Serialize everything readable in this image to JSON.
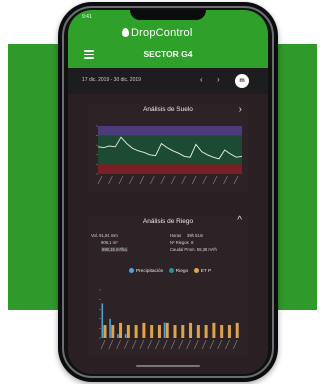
{
  "status": {
    "time": "9:41"
  },
  "app": {
    "name": "DropControl",
    "screen_title": "SECTOR G4"
  },
  "date_range": {
    "label": "17 dic. 2019 - 30 dic. 2019",
    "prev": "‹",
    "next": "›",
    "mode": "m"
  },
  "soil_card": {
    "title": "Análisis de Suelo",
    "chevron": "›",
    "series_color": "#e9f2ee",
    "band_colors": {
      "top": "#4b3b7a",
      "middle": "#1c4a33",
      "bottom": "#7a1f24"
    },
    "values": [
      34,
      33,
      35,
      34,
      46,
      38,
      32,
      29,
      27,
      24,
      23,
      38,
      33,
      29,
      26,
      22,
      21,
      37,
      28,
      24,
      21,
      19,
      30,
      25,
      21,
      22
    ]
  },
  "irrigation_card": {
    "title": "Análisis de Riego",
    "chevron": "^",
    "stats_left": [
      {
        "label": "Vol.",
        "value": "91,91 mm"
      },
      {
        "label": "",
        "value": "909,1 m³"
      },
      {
        "label": "",
        "value": "690,15 m³/ha"
      }
    ],
    "stats_right": [
      {
        "label": "Horas",
        "value": "39h 51m"
      },
      {
        "label": "Nº Riegos",
        "value": "8"
      },
      {
        "label": "Caudal Prom.",
        "value": "59,38 m³/h"
      }
    ],
    "legend": [
      {
        "label": "Precipitación",
        "color": "#4aa3df"
      },
      {
        "label": "Riego",
        "color": "#2c8fa0"
      },
      {
        "label": "ET P",
        "color": "#e0a24a"
      }
    ],
    "bars": {
      "et_color": "#e0a24a",
      "rain_color": "#4aa3df",
      "et_values": [
        0.6,
        0.6,
        0.7,
        0.6,
        0.6,
        0.7,
        0.6,
        0.6,
        0.7,
        0.6,
        0.6,
        0.7,
        0.6,
        0.6,
        0.7,
        0.6,
        0.6,
        0.7
      ],
      "rain_values": [
        0.9,
        0.5,
        0.1,
        0.1,
        0.0,
        0.0,
        0.0,
        0.0,
        0.4,
        0.0,
        0.0,
        0.0,
        0.0,
        0.0,
        0.0,
        0.0,
        0.0,
        0.0
      ]
    }
  }
}
